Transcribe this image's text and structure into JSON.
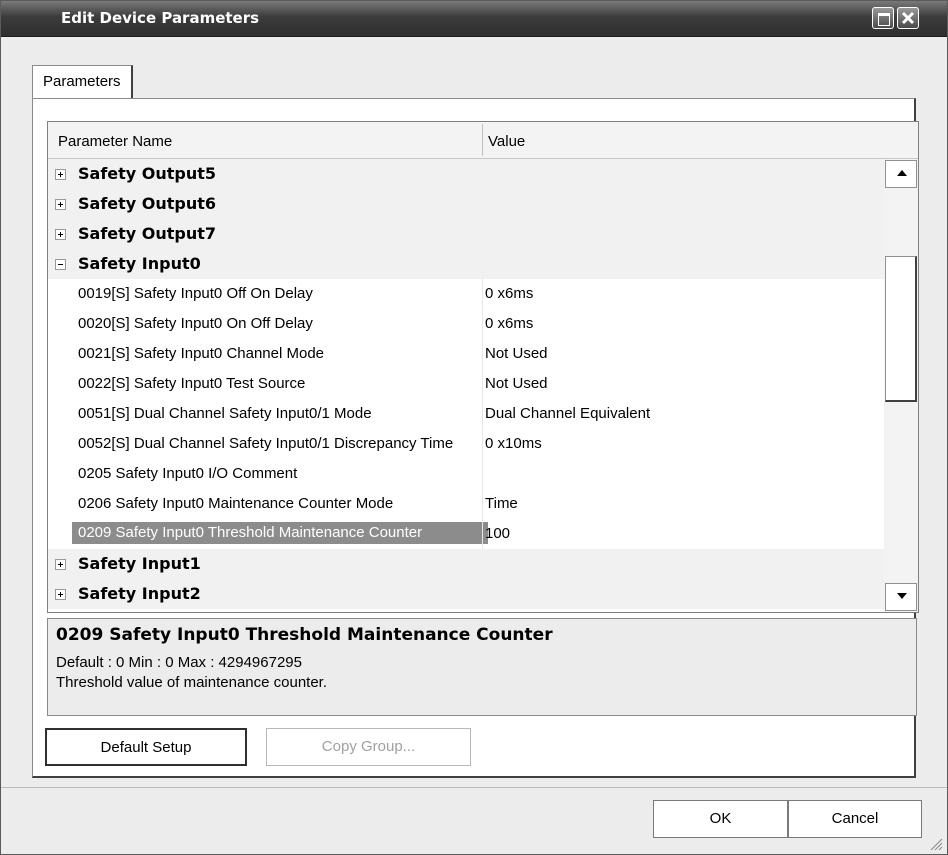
{
  "window": {
    "title": "Edit Device Parameters"
  },
  "tabs": [
    {
      "label": "Parameters"
    }
  ],
  "grid": {
    "columns": {
      "name": "Parameter Name",
      "value": "Value"
    },
    "rows": [
      {
        "type": "group",
        "expanded": false,
        "label": "Safety Output5"
      },
      {
        "type": "group",
        "expanded": false,
        "label": "Safety Output6"
      },
      {
        "type": "group",
        "expanded": false,
        "label": "Safety Output7"
      },
      {
        "type": "group",
        "expanded": true,
        "label": "Safety Input0"
      },
      {
        "type": "param",
        "name": "0019[S] Safety Input0 Off On Delay",
        "value": "0 x6ms"
      },
      {
        "type": "param",
        "name": "0020[S] Safety Input0 On Off Delay",
        "value": "0 x6ms"
      },
      {
        "type": "param",
        "name": "0021[S] Safety Input0 Channel Mode",
        "value": "Not Used"
      },
      {
        "type": "param",
        "name": "0022[S] Safety Input0 Test Source",
        "value": "Not Used"
      },
      {
        "type": "param",
        "name": "0051[S] Dual Channel Safety Input0/1 Mode",
        "value": "Dual Channel Equivalent"
      },
      {
        "type": "param",
        "name": "0052[S] Dual Channel Safety Input0/1 Discrepancy Time",
        "value": "0 x10ms"
      },
      {
        "type": "param",
        "name": "0205 Safety Input0 I/O Comment",
        "value": ""
      },
      {
        "type": "param",
        "name": "0206 Safety Input0 Maintenance Counter Mode",
        "value": "Time"
      },
      {
        "type": "param",
        "name": "0209 Safety Input0 Threshold Maintenance Counter",
        "value": "100",
        "selected": true
      },
      {
        "type": "group",
        "expanded": false,
        "label": "Safety Input1"
      },
      {
        "type": "group",
        "expanded": false,
        "label": "Safety Input2"
      }
    ]
  },
  "description": {
    "title": "0209 Safety Input0 Threshold Maintenance Counter",
    "range": "Default : 0   Min : 0   Max : 4294967295",
    "text": "Threshold value of maintenance counter."
  },
  "buttons": {
    "default_setup": "Default Setup",
    "copy_group": "Copy Group...",
    "ok": "OK",
    "cancel": "Cancel"
  },
  "icons": {
    "maximize": "maximize-icon",
    "close": "close-icon",
    "expand": "plus-box-icon",
    "collapse": "minus-box-icon",
    "scroll_up": "up-arrow-icon",
    "scroll_down": "down-arrow-icon"
  }
}
